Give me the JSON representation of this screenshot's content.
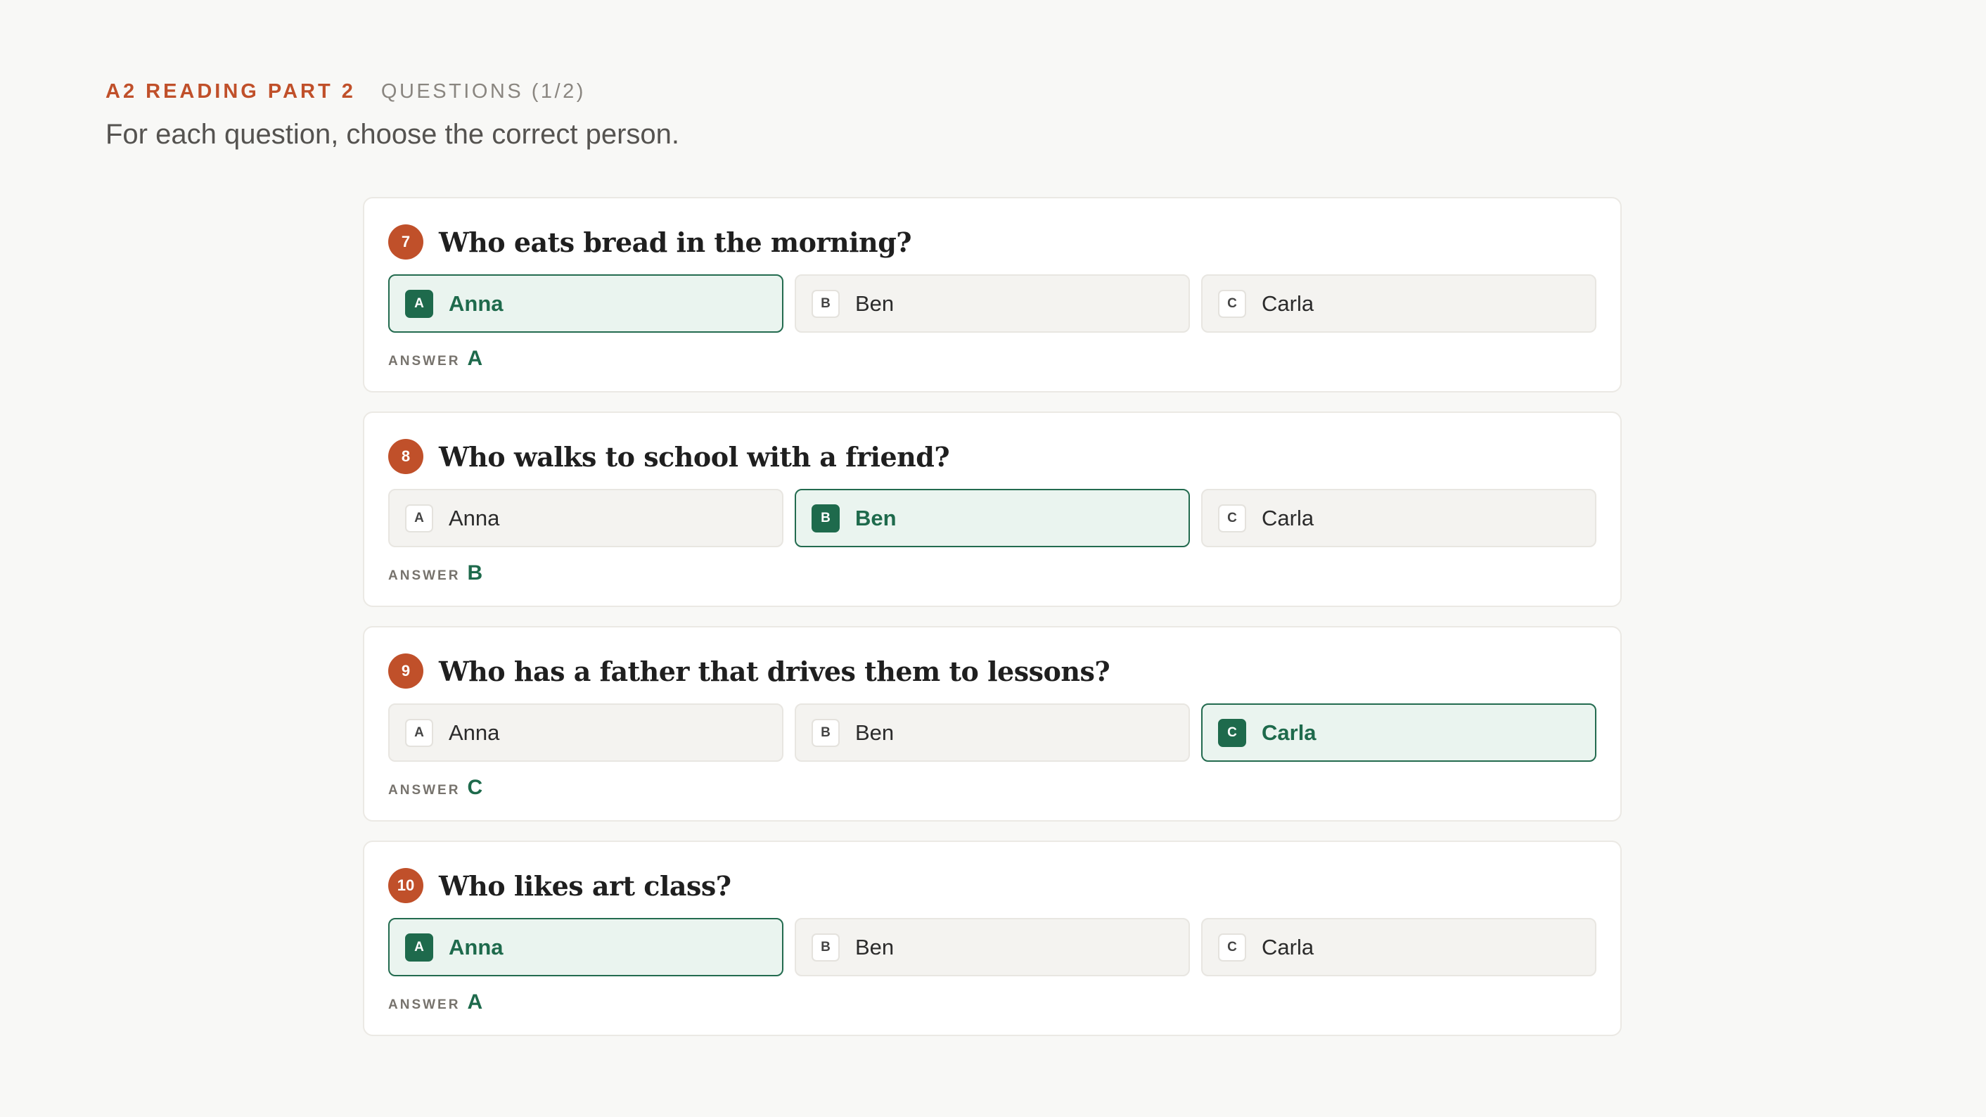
{
  "header": {
    "section": "A2 READING PART 2",
    "progress": "QUESTIONS (1/2)",
    "instruction": "For each question, choose the correct person."
  },
  "answer_label": "ANSWER",
  "colors": {
    "accent": "#c0502a",
    "correct": "#1e6a4c",
    "correct_bg": "#eaf4ef",
    "background": "#f8f8f6"
  },
  "questions": [
    {
      "number": "7",
      "text": "Who eats bread in the morning?",
      "options": [
        {
          "key": "A",
          "name": "Anna",
          "selected": true
        },
        {
          "key": "B",
          "name": "Ben",
          "selected": false
        },
        {
          "key": "C",
          "name": "Carla",
          "selected": false
        }
      ],
      "answer": "A"
    },
    {
      "number": "8",
      "text": "Who walks to school with a friend?",
      "options": [
        {
          "key": "A",
          "name": "Anna",
          "selected": false
        },
        {
          "key": "B",
          "name": "Ben",
          "selected": true
        },
        {
          "key": "C",
          "name": "Carla",
          "selected": false
        }
      ],
      "answer": "B"
    },
    {
      "number": "9",
      "text": "Who has a father that drives them to lessons?",
      "options": [
        {
          "key": "A",
          "name": "Anna",
          "selected": false
        },
        {
          "key": "B",
          "name": "Ben",
          "selected": false
        },
        {
          "key": "C",
          "name": "Carla",
          "selected": true
        }
      ],
      "answer": "C"
    },
    {
      "number": "10",
      "text": "Who likes art class?",
      "options": [
        {
          "key": "A",
          "name": "Anna",
          "selected": true
        },
        {
          "key": "B",
          "name": "Ben",
          "selected": false
        },
        {
          "key": "C",
          "name": "Carla",
          "selected": false
        }
      ],
      "answer": "A"
    }
  ]
}
